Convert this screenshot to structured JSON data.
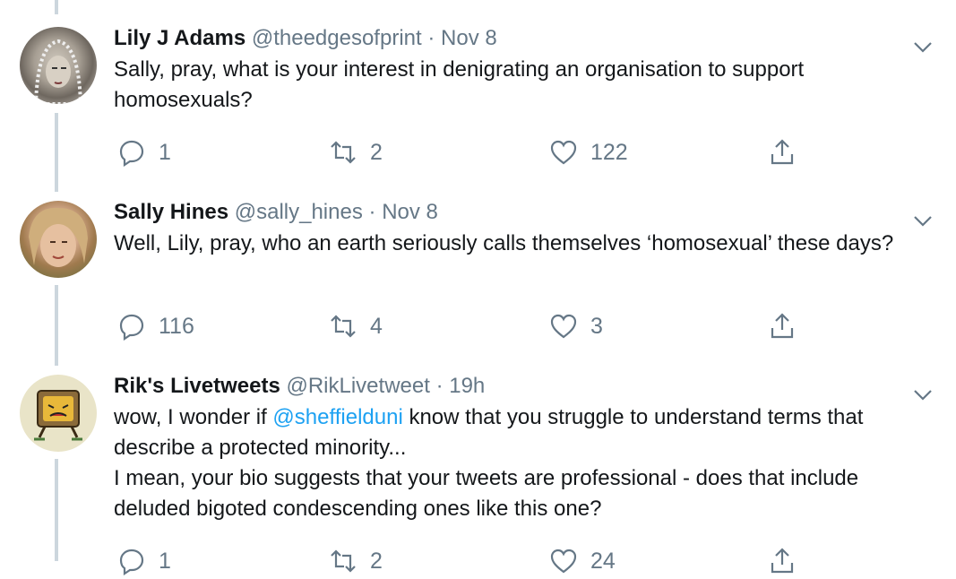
{
  "tweets": [
    {
      "name": "Lily J Adams",
      "handle": "@theedgesofprint",
      "sep": "·",
      "time": "Nov 8",
      "text": "Sally, pray, what is your interest in denigrating an organisation to support homosexuals?",
      "replies": "1",
      "retweets": "2",
      "likes": "122"
    },
    {
      "name": "Sally Hines",
      "handle": "@sally_hines",
      "sep": "·",
      "time": "Nov 8",
      "text": "Well, Lily, pray, who an earth seriously calls themselves ‘homosexual’ these days?",
      "replies": "116",
      "retweets": "4",
      "likes": "3"
    },
    {
      "name": "Rik's Livetweets",
      "handle": "@RikLivetweet",
      "sep": "·",
      "time": "19h",
      "text_pre": "wow, I wonder if ",
      "mention": "@sheffielduni",
      "text_post": " know that you struggle to understand terms that describe a protected minority...",
      "text_line2": "I mean, your bio suggests that your tweets are professional - does that include deluded bigoted condescending ones like this one?",
      "replies": "1",
      "retweets": "2",
      "likes": "24"
    }
  ],
  "colors": {
    "name": "#14171a",
    "meta": "#657786",
    "link": "#1da1f2",
    "thread": "#ccd6dd"
  },
  "icons": [
    "reply-icon",
    "retweet-icon",
    "like-icon",
    "share-icon",
    "chevron-down-icon"
  ]
}
